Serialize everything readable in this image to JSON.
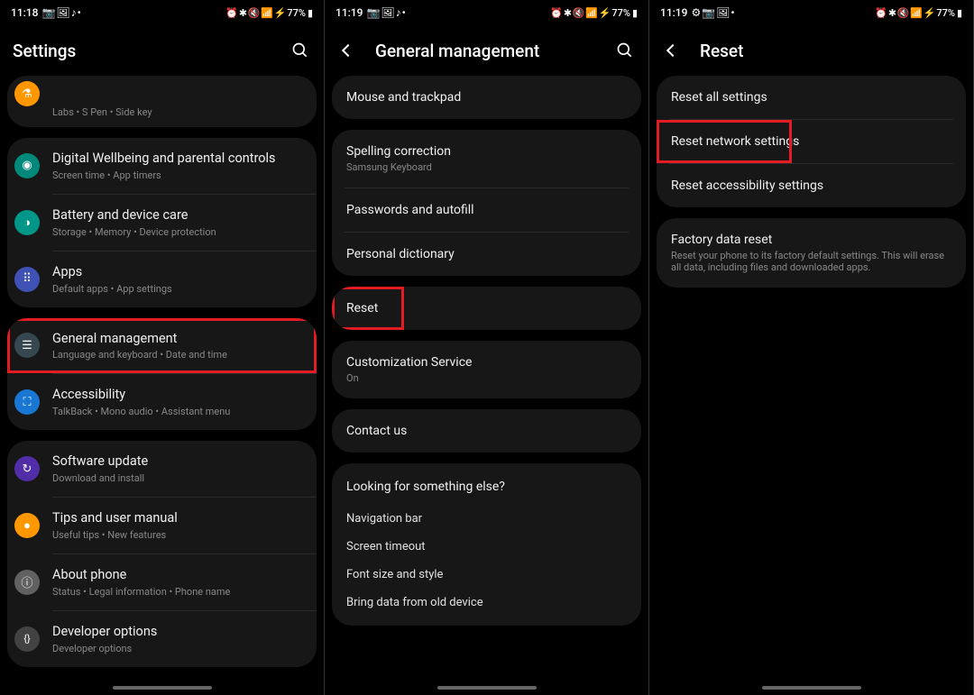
{
  "screens": [
    {
      "statusbar": {
        "time": "11:18",
        "left_icons": "📷 🖼 ♪ •",
        "right_icons": "⏰ ✱ 🔇 📶 ⚡",
        "battery": "77%"
      },
      "header": {
        "title": "Settings",
        "back": false,
        "search": true
      },
      "groups": [
        {
          "items": [
            {
              "icon": "ic-labs",
              "glyph": "⚗",
              "title": "",
              "sub": "Labs  •  S Pen  •  Side key",
              "partial": true
            }
          ]
        },
        {
          "items": [
            {
              "icon": "ic-wellbeing",
              "glyph": "◉",
              "title": "Digital Wellbeing and parental controls",
              "sub": "Screen time  •  App timers"
            },
            {
              "icon": "ic-battery",
              "glyph": "◑",
              "title": "Battery and device care",
              "sub": "Storage  •  Memory  •  Device protection"
            },
            {
              "icon": "ic-apps",
              "glyph": "⠿",
              "title": "Apps",
              "sub": "Default apps  •  App settings"
            }
          ]
        },
        {
          "items": [
            {
              "icon": "ic-general",
              "glyph": "☰",
              "title": "General management",
              "sub": "Language and keyboard  •  Date and time",
              "highlight": true
            },
            {
              "icon": "ic-accessibility",
              "glyph": "⛶",
              "title": "Accessibility",
              "sub": "TalkBack  •  Mono audio  •  Assistant menu"
            }
          ]
        },
        {
          "items": [
            {
              "icon": "ic-software",
              "glyph": "↻",
              "title": "Software update",
              "sub": "Download and install"
            },
            {
              "icon": "ic-tips",
              "glyph": "●",
              "title": "Tips and user manual",
              "sub": "Useful tips  •  New features"
            },
            {
              "icon": "ic-about",
              "glyph": "ⓘ",
              "title": "About phone",
              "sub": "Status  •  Legal information  •  Phone name"
            },
            {
              "icon": "ic-developer",
              "glyph": "{}",
              "title": "Developer options",
              "sub": "Developer options"
            }
          ]
        }
      ]
    },
    {
      "statusbar": {
        "time": "11:19",
        "left_icons": "📷 🖼 ♪ •",
        "right_icons": "⏰ ✱ 🔇 📶 ⚡",
        "battery": "77%"
      },
      "header": {
        "title": "General management",
        "back": true,
        "search": true
      },
      "simplegroups": [
        {
          "items": [
            {
              "title": "Mouse and trackpad"
            }
          ]
        },
        {
          "items": [
            {
              "title": "Spelling correction",
              "sub": "Samsung Keyboard"
            },
            {
              "title": "Passwords and autofill"
            },
            {
              "title": "Personal dictionary"
            }
          ]
        },
        {
          "items": [
            {
              "title": "Reset",
              "highlight": true
            }
          ]
        },
        {
          "items": [
            {
              "title": "Customization Service",
              "sub": "On"
            }
          ]
        },
        {
          "items": [
            {
              "title": "Contact us"
            }
          ]
        }
      ],
      "looking": {
        "heading": "Looking for something else?",
        "links": [
          "Navigation bar",
          "Screen timeout",
          "Font size and style",
          "Bring data from old device"
        ]
      }
    },
    {
      "statusbar": {
        "time": "11:19",
        "left_icons": "⚙ 📷 🖼 •",
        "right_icons": "⏰ ✱ 🔇 📶 ⚡",
        "battery": "77%"
      },
      "header": {
        "title": "Reset",
        "back": true,
        "search": false
      },
      "simplegroups": [
        {
          "items": [
            {
              "title": "Reset all settings"
            },
            {
              "title": "Reset network settings",
              "highlight": true
            },
            {
              "title": "Reset accessibility settings"
            }
          ]
        },
        {
          "items": [
            {
              "title": "Factory data reset",
              "sub": "Reset your phone to its factory default settings. This will erase all data, including files and downloaded apps."
            }
          ]
        }
      ]
    }
  ]
}
